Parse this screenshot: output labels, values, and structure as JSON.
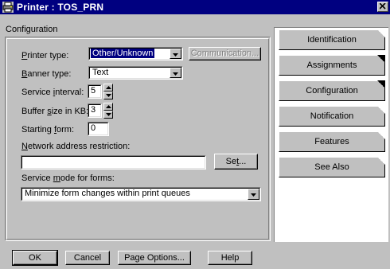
{
  "window": {
    "title": "Printer : TOS_PRN",
    "close_symbol": "X"
  },
  "group": {
    "label": "Configuration"
  },
  "fields": {
    "printer_type": {
      "label_hot": "P",
      "label_rest": "rinter type:",
      "value": "Other/Unknown"
    },
    "communication_button": "Communication...",
    "banner_type": {
      "label_hot": "B",
      "label_rest": "anner type:",
      "value": "Text"
    },
    "service_interval": {
      "label_pre": "Service ",
      "label_hot": "i",
      "label_rest": "nterval:",
      "value": "5"
    },
    "buffer_size": {
      "label_pre": "Buffer ",
      "label_hot": "s",
      "label_rest": "ize in KB:",
      "value": "3"
    },
    "starting_form": {
      "label_pre": "Starting ",
      "label_hot": "f",
      "label_rest": "orm:",
      "value": "0"
    },
    "network_address": {
      "label_hot": "N",
      "label_rest": "etwork address restriction:",
      "value": ""
    },
    "set_button": {
      "pre": "Se",
      "hot": "t",
      "rest": "..."
    },
    "service_mode": {
      "label_pre": "Service ",
      "label_hot": "m",
      "label_rest": "ode for forms:",
      "value": "Minimize form changes within print queues"
    }
  },
  "buttons": {
    "ok": "OK",
    "cancel": "Cancel",
    "page_options": "Page Options...",
    "help": "Help"
  },
  "tabs": [
    {
      "label": "Identification",
      "fold": "white"
    },
    {
      "label": "Assignments",
      "fold": "black"
    },
    {
      "label": "Configuration",
      "fold": "black"
    },
    {
      "label": "Notification",
      "fold": "white"
    },
    {
      "label": "Features",
      "fold": "white"
    },
    {
      "label": "See Also",
      "fold": "white"
    }
  ],
  "colors": {
    "titlebar": "#000080",
    "face": "#c0c0c0"
  }
}
